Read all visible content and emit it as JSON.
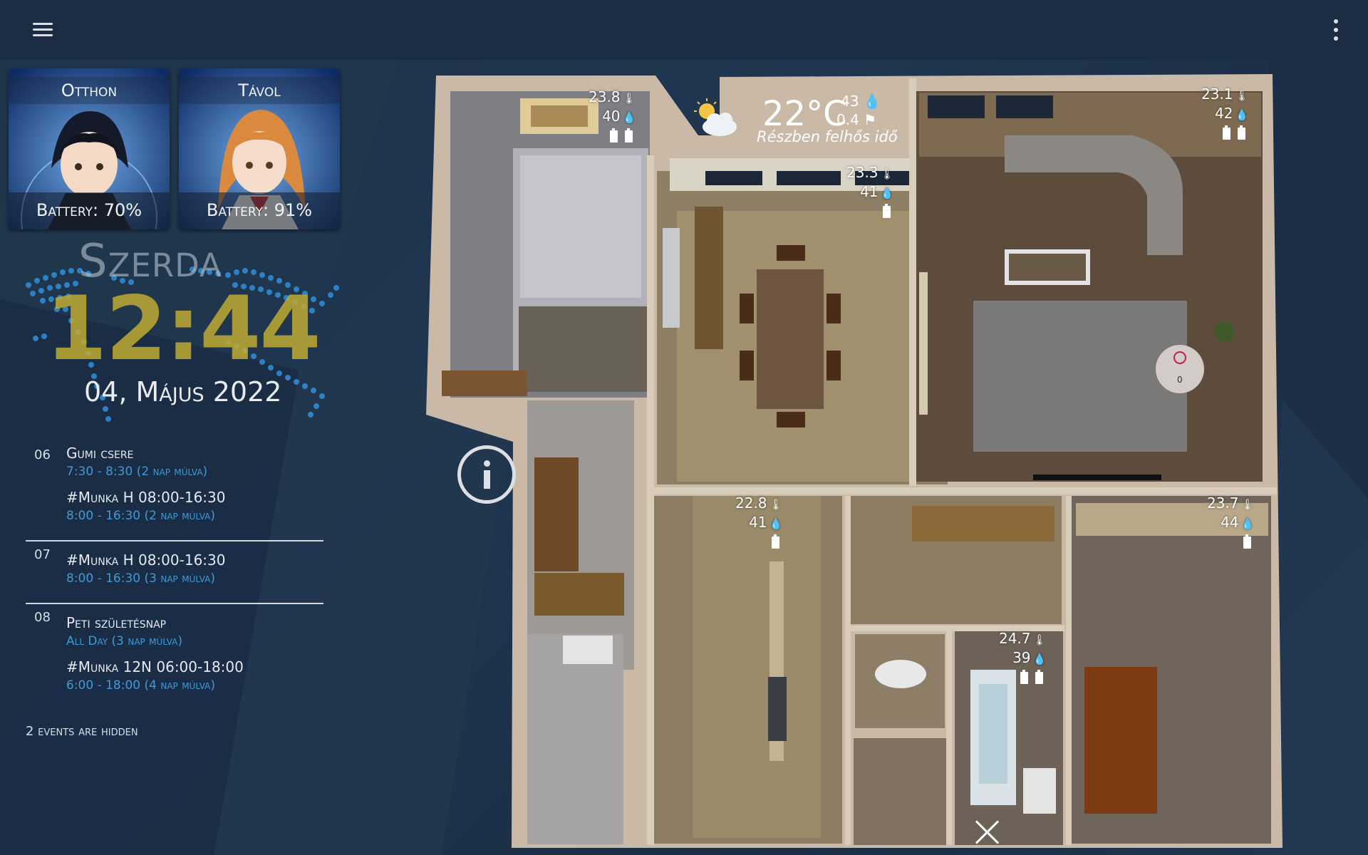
{
  "colors": {
    "background": "#1f334b",
    "topbar": "#1c2c42",
    "accent_time": "#3d9ad6",
    "clock_gold": "#bfa832"
  },
  "header": {
    "menu_icon": "hamburger-menu-icon",
    "more_icon": "more-vertical-icon"
  },
  "presence": [
    {
      "label": "Otthon",
      "battery": "Battery: 70%"
    },
    {
      "label": "Távol",
      "battery": "Battery: 91%"
    }
  ],
  "clock": {
    "day": "Szerda",
    "time": "12:44",
    "date": "04, Május 2022"
  },
  "agenda": {
    "days": [
      {
        "num": "06",
        "events": [
          {
            "title": "Gumi csere",
            "time": "7:30 - 8:30  (2 nap múlva)"
          },
          {
            "title": "#Munka H 08:00-16:30",
            "time": "8:00 - 16:30  (2 nap múlva)"
          }
        ]
      },
      {
        "num": "07",
        "events": [
          {
            "title": "#Munka H 08:00-16:30",
            "time": "8:00 - 16:30  (3 nap múlva)"
          }
        ]
      },
      {
        "num": "08",
        "events": [
          {
            "title": "Peti születésnap",
            "time": "All Day  (3 nap múlva)"
          },
          {
            "title": "#Munka 12N 06:00-18:00",
            "time": "6:00 - 18:00     (4 nap múlva)"
          }
        ]
      }
    ],
    "hidden_note": "2 events are hidden"
  },
  "weather": {
    "icon": "partly-cloudy-icon",
    "temp": "22°C",
    "humidity": "43",
    "wind": "0.4",
    "description": "Részben felhős idő"
  },
  "sensors": [
    {
      "id": "bedroom",
      "temp": "23.8",
      "humidity": "40",
      "batteries": 2
    },
    {
      "id": "kitchen",
      "temp": "23.3",
      "humidity": "41",
      "batteries": 1
    },
    {
      "id": "living",
      "temp": "23.1",
      "humidity": "42",
      "batteries": 2
    },
    {
      "id": "hall",
      "temp": "22.8",
      "humidity": "41",
      "batteries": 1
    },
    {
      "id": "room",
      "temp": "23.7",
      "humidity": "44",
      "batteries": 1
    },
    {
      "id": "bath",
      "temp": "24.7",
      "humidity": "39",
      "batteries": 2
    }
  ],
  "floorplan": {
    "vacuum_counter": "0"
  }
}
